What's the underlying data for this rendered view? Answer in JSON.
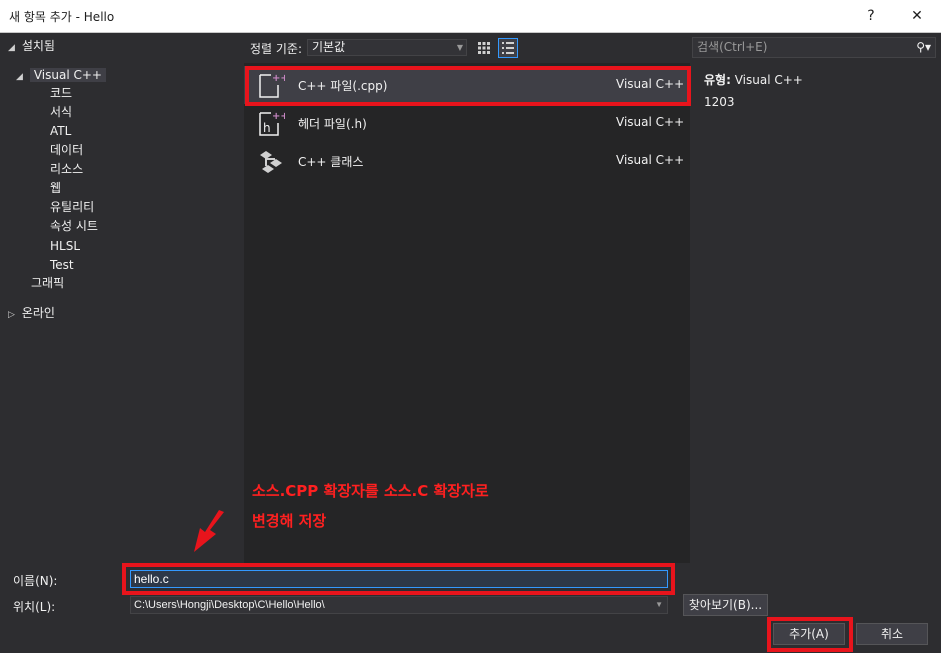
{
  "window": {
    "title": "새 항목 추가 - Hello",
    "help": "?",
    "close": "✕"
  },
  "tree": {
    "installed": "설치됨",
    "visual_cpp": "Visual C++",
    "children": [
      "코드",
      "서식",
      "ATL",
      "데이터",
      "리소스",
      "웹",
      "유틸리티",
      "속성 시트",
      "HLSL",
      "Test"
    ],
    "graphics": "그래픽",
    "online": "온라인"
  },
  "sort": {
    "label": "정렬 기준:",
    "value": "기본값"
  },
  "items": [
    {
      "name": "C++ 파일(.cpp)",
      "lang": "Visual C++"
    },
    {
      "name": "헤더 파일(.h)",
      "lang": "Visual C++"
    },
    {
      "name": "C++ 클래스",
      "lang": "Visual C++"
    }
  ],
  "search": {
    "placeholder": "검색(Ctrl+E)"
  },
  "info": {
    "type_label": "유형:",
    "type_value": "Visual C++",
    "number": "1203"
  },
  "annotation": {
    "line1": "소스.CPP 확장자를 소스.C 확장자로",
    "line2": "변경해 저장"
  },
  "form": {
    "name_label": "이름(N):",
    "name_value": "hello.c",
    "location_label": "위치(L):",
    "location_value": "C:\\Users\\Hongji\\Desktop\\C\\Hello\\Hello\\"
  },
  "buttons": {
    "browse": "찾아보기(B)...",
    "add": "추가(A)",
    "cancel": "취소"
  },
  "colors": {
    "accent": "#3399ff",
    "highlight": "#e8141c",
    "bg": "#2d2d30"
  }
}
